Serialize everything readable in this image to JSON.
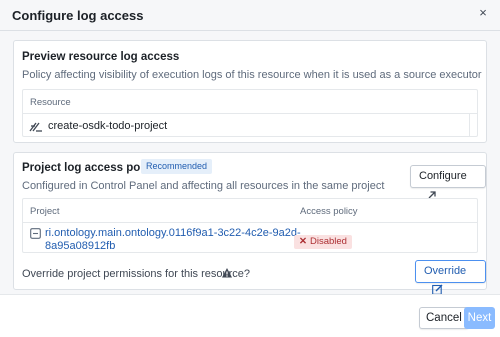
{
  "dialog": {
    "title": "Configure log access",
    "close_glyph": "×"
  },
  "preview": {
    "title": "Preview resource log access",
    "subtitle": "Policy affecting visibility of execution logs of this resource when it is used as a source executor",
    "table_header": "Resource",
    "resource_name": "create-osdk-todo-project",
    "resource_icon": "resource-icon"
  },
  "project_policy": {
    "title": "Project log access policy",
    "badge": "Recommended",
    "subtitle": "Configured in Control Panel and affecting all resources in the same project",
    "configure_label": "Configure",
    "configure_icon": "share-icon",
    "columns": [
      "Project",
      "Access policy"
    ],
    "project_link_line1": "ri.ontology.main.ontology.0116f9a1-3c22-4c2e-9a2d-",
    "project_link_line2": "8a95a08912fb",
    "access_policy": "Disabled",
    "override_question": "Override project permissions for this resource?",
    "override_label": "Override",
    "override_icon": "edit-icon"
  },
  "footer": {
    "cancel_label": "Cancel",
    "next_label": "Next"
  },
  "colors": {
    "accent": "#215db0",
    "danger": "#ac2f33",
    "primary_disabled": "#8abbff"
  }
}
